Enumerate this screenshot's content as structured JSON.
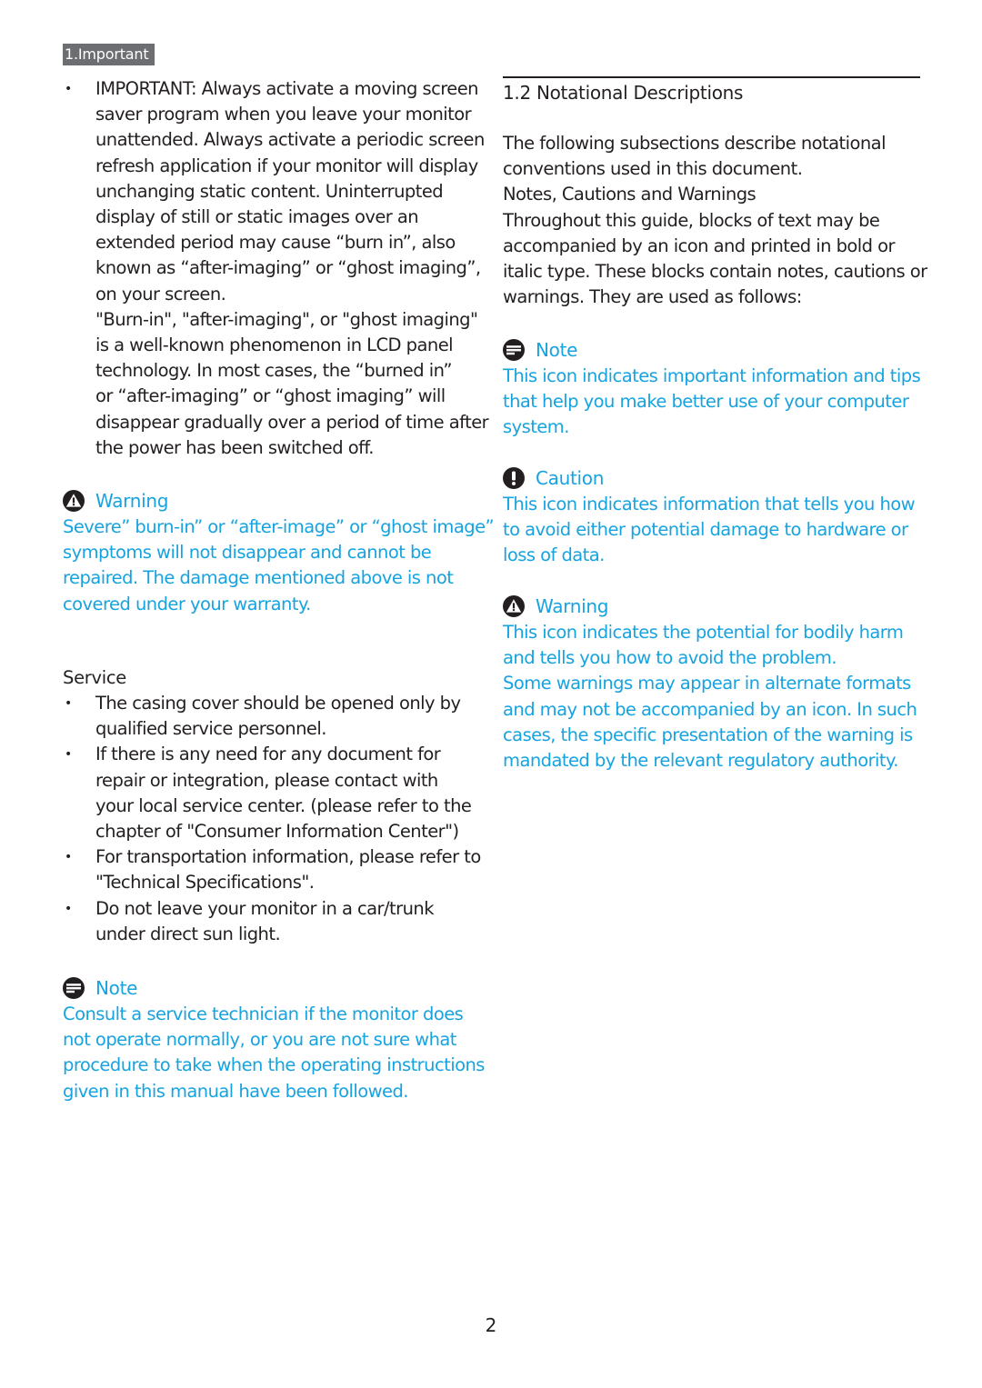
{
  "section_tab": "1.Important",
  "left": {
    "important_bullet": {
      "lines": [
        "IMPORTANT: Always activate a moving screen",
        "saver program when you leave your monitor",
        "unattended. Always activate a periodic screen",
        "refresh application if your monitor will display",
        "unchanging static content. Uninterrupted",
        "display of still or static images over an",
        "extended period may cause “burn in”, also",
        "known as “after-imaging” or “ghost imaging”,",
        "on your screen.",
        "\"Burn-in\", \"after-imaging\", or \"ghost imaging\"",
        "is a well-known phenomenon in LCD panel",
        "technology. In most cases, the “burned in”",
        "or “after-imaging” or “ghost imaging” will",
        "disappear gradually over a period of time after",
        "the power has been switched off."
      ]
    },
    "warning": {
      "icon": "warning-triangle-icon",
      "label": "Warning",
      "lines": [
        "Severe” burn-in” or “after-image” or “ghost image”",
        "symptoms will not disappear and cannot be",
        "repaired. The damage mentioned above is not",
        "covered under your warranty."
      ]
    },
    "service": {
      "heading": "Service",
      "bullets": [
        [
          "The casing cover should be opened only by",
          "qualified service personnel."
        ],
        [
          "If there is any need for any document for",
          "repair or integration, please contact with",
          "your local service center. (please refer to the",
          "chapter of \"Consumer Information Center\")"
        ],
        [
          "For transportation information, please refer to",
          "\"Technical Specifications\"."
        ],
        [
          "Do not leave your monitor in a car/trunk",
          "under direct sun light."
        ]
      ]
    },
    "note": {
      "icon": "note-icon",
      "label": "Note",
      "lines": [
        "Consult a service technician if the monitor does",
        "not operate normally, or you are not sure what",
        "procedure to take when the operating instructions",
        "given in this manual have been followed."
      ]
    }
  },
  "right": {
    "heading": "1.2 Notational Descriptions",
    "intro_lines": [
      "The following subsections describe notational",
      "conventions used in this document.",
      "Notes, Cautions and Warnings",
      "Throughout this guide, blocks of text may be",
      "accompanied by an icon and printed in bold or",
      "italic type. These blocks contain notes, cautions or",
      "warnings. They are used as follows:"
    ],
    "note": {
      "icon": "note-icon",
      "label": "Note",
      "lines": [
        "This icon indicates important information and tips",
        "that help you make better use of your computer",
        "system."
      ]
    },
    "caution": {
      "icon": "caution-exclamation-icon",
      "label": "Caution",
      "lines": [
        "This icon indicates information that tells you how",
        "to avoid either potential damage to hardware or",
        "loss of data."
      ]
    },
    "warning": {
      "icon": "warning-triangle-icon",
      "label": "Warning",
      "lines": [
        "This icon indicates the potential for bodily harm",
        "and tells you how to avoid the problem.",
        "Some warnings may appear in alternate formats",
        "and may not be accompanied by an icon. In such",
        "cases, the specific presentation of the warning is",
        "mandated by the relevant regulatory authority."
      ]
    }
  },
  "page_number": "2",
  "colors": {
    "text": "#231f20",
    "accent_blue": "#16a3e0",
    "tab_bg": "#6d6e71"
  }
}
